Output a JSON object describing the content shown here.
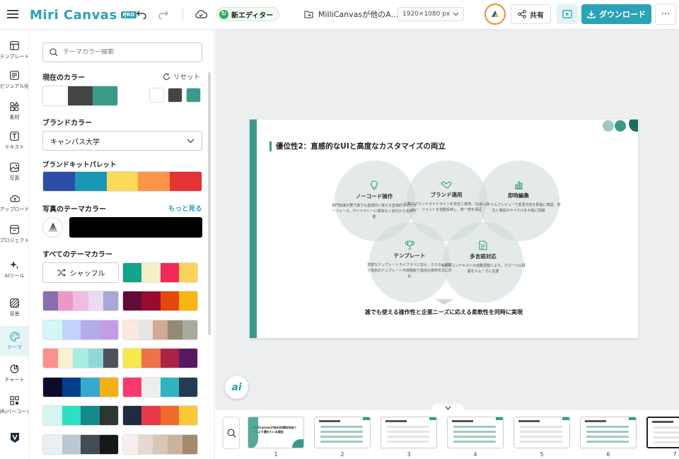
{
  "app": {
    "logo_text": "Miri Canvas",
    "logo_badge": "PRO",
    "new_editor_label": "新エディター",
    "document_name": "MilliCanvasが他のA…",
    "canvas_size": "1920×1080 px",
    "share_label": "共有",
    "download_label": "ダウンロード"
  },
  "sidebar": {
    "items": [
      {
        "label": "テンプレート",
        "icon": "template-icon"
      },
      {
        "label": "ビジュアル化",
        "icon": "visualize-icon"
      },
      {
        "label": "素材",
        "icon": "elements-icon"
      },
      {
        "label": "テキスト",
        "icon": "text-icon"
      },
      {
        "label": "写真",
        "icon": "photo-icon"
      },
      {
        "label": "アップロード",
        "icon": "upload-icon"
      },
      {
        "label": "プロジェクト",
        "icon": "project-icon"
      },
      {
        "label": "AIツール",
        "icon": "ai-tools-icon"
      },
      {
        "label": "背景",
        "icon": "background-icon"
      },
      {
        "label": "テーマ",
        "icon": "theme-icon"
      },
      {
        "label": "チャート",
        "icon": "chart-icon"
      },
      {
        "label": "QR/バーコード",
        "icon": "qr-code-icon"
      },
      {
        "label": "",
        "icon": "brand-logo-icon"
      }
    ]
  },
  "panel": {
    "search_placeholder": "テーマカラー検索",
    "current_colors_title": "現在のカラー",
    "reset_label": "リセット",
    "current_colors": [
      "#ffffff",
      "#444444",
      "#3a9a8a"
    ],
    "brand_title": "ブランドカラー",
    "brand_selected": "キャンパス大学",
    "brand_kit_title": "ブランドキットパレット",
    "brand_kit_colors": [
      "#2b4ea8",
      "#1997b4",
      "#fad85a",
      "#fb9648",
      "#e53232"
    ],
    "photo_theme_title": "写真のテーマカラー",
    "more_label": "もっと見る",
    "all_themes_title": "すべてのテーマカラー",
    "shuffle_label": "シャッフル",
    "themes": [
      [
        "#12a38a",
        "#f5f0c8",
        "#f0295a",
        "#fbd35a"
      ],
      [
        "#8a6fae",
        "#ec98c6",
        "#efbde2",
        "#eadcee",
        "#a9a8d8"
      ],
      [
        "#5e0d3b",
        "#980b2f",
        "#e5470e",
        "#f8b711"
      ],
      [
        "#d3f8f6",
        "#c2d2fb",
        "#b3acea",
        "#c39ce8"
      ],
      [
        "#fbe9df",
        "#e8e6e2",
        "#d2a896",
        "#928a76",
        "#a9aa99"
      ],
      [
        "#fd8f8c",
        "#fbf0d1",
        "#a7ede0",
        "#92d7d7",
        "#4e525a"
      ],
      [
        "#f6ea4c",
        "#ee7149",
        "#ad2247",
        "#57195f"
      ],
      [
        "#0c0c2d",
        "#033f8d",
        "#36a8cf",
        "#f5af16"
      ],
      [
        "#f93a6e",
        "#eeeeee",
        "#30b3c0",
        "#253b54"
      ],
      [
        "#d4f8ef",
        "#2be1c2",
        "#148b8a",
        "#2c3632"
      ],
      [
        "#1f2b3e",
        "#e8394b",
        "#ee6b2b",
        "#fac73c"
      ],
      [
        "#eaeff3",
        "#bcc8d1",
        "#434b54",
        "#151719"
      ],
      [
        "#f7eeef",
        "#e6d9d2",
        "#d8c6b7",
        "#cbb49d",
        "#a58a6d"
      ]
    ]
  },
  "slide": {
    "title": "優位性2：直感的なUIと高度なカスタマイズの両立",
    "features": [
      {
        "heading": "ノーコード操作",
        "body": "専門知識不要で誰でも直感的に使える直感的なインターフェース。ITリテラシーに関係なく初日から活用可能",
        "icon": "bulb-icon"
      },
      {
        "heading": "ブランド適用",
        "body": "企業のブランドガイドラインを完全に適用。ロゴ、カラー、フォントを自動反映し、統一感を保証",
        "icon": "handshake-icon"
      },
      {
        "heading": "即時編集",
        "body": "リアルタイムプレビューで変更内容を即座に確認。修正と確認のサイクルを大幅に短縮",
        "icon": "bar-chart-icon"
      },
      {
        "heading": "テンプレート",
        "body": "豊富なテンプレートライブラリに加え、カスタム対応で独自のテンプレート作成機能で独自の資料形式に対応",
        "icon": "trophy-icon"
      },
      {
        "heading": "多言語対応",
        "body": "文化的コンテキストの自動調整により、グローバル展開をスムーズに支援",
        "icon": "document-icon"
      }
    ],
    "footer": "誰でも使える操作性と企業ニーズに応える柔軟性を同時に実現"
  },
  "filmstrip": {
    "pages": [
      "1",
      "2",
      "3",
      "4",
      "5",
      "6",
      "7"
    ],
    "thumb1_title": "MilliCanvasが他のAI資料作成ツールより優れている理由"
  },
  "colors": {
    "accent": "#2aa3b5",
    "slide_accent": "#3a9a8a"
  }
}
